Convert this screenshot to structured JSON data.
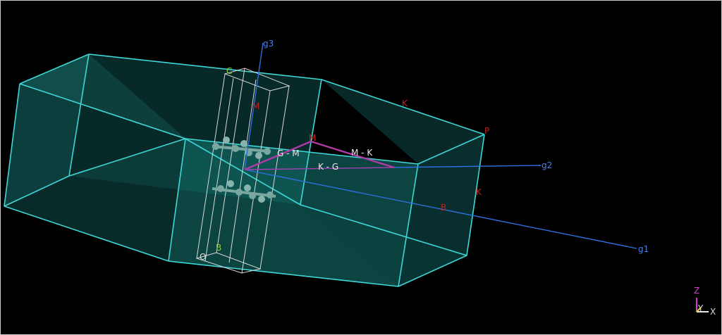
{
  "view": {
    "axes": {
      "g1": "g1",
      "g2": "g2",
      "g3": "g3"
    },
    "kpoints": {
      "m_left": "M",
      "m_path": "M",
      "k_top": "K",
      "k_right": "K",
      "p": "P",
      "b_red": "B",
      "c": "C",
      "b_green": "B",
      "o": "O"
    },
    "path_labels": {
      "g_m": "G - M",
      "m_k": "M - K",
      "k_g": "K - G"
    },
    "triad": {
      "z": "Z",
      "y": "Y",
      "x": "X"
    }
  },
  "colors": {
    "background": "#000000",
    "bz_edge": "#3fd6d6",
    "bz_face": "#0f5d5a",
    "reciprocal_axis": "#2f6fdf",
    "path": "#b03aa6",
    "cell": "#d8d8d8",
    "atom": "#7aa6a0",
    "kpoint_label": "#c02222",
    "cell_label": "#8ecf3a",
    "white_label": "#e8e8e8"
  }
}
